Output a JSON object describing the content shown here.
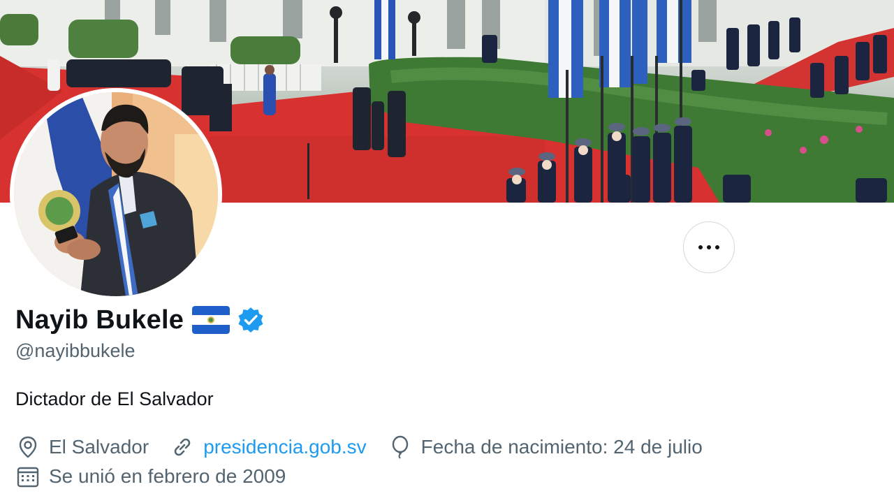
{
  "profile": {
    "display_name": "Nayib Bukele",
    "handle": "@nayibbukele",
    "bio": "Dictador de El Salvador",
    "flag_icon": "el-salvador-flag",
    "verified_icon": "verified-badge-icon",
    "verified_color": "#1d9bf0"
  },
  "meta": {
    "location": "El Salvador",
    "website": "presidencia.gob.sv",
    "birthday": "Fecha de nacimiento: 24 de julio",
    "joined": "Se unió en febrero de 2009"
  },
  "actions": {
    "more_icon": "more-options-icon"
  },
  "colors": {
    "link": "#1d9bf0",
    "secondary_text": "#536471",
    "primary_text": "#0f1419",
    "border": "#cfd9de"
  }
}
